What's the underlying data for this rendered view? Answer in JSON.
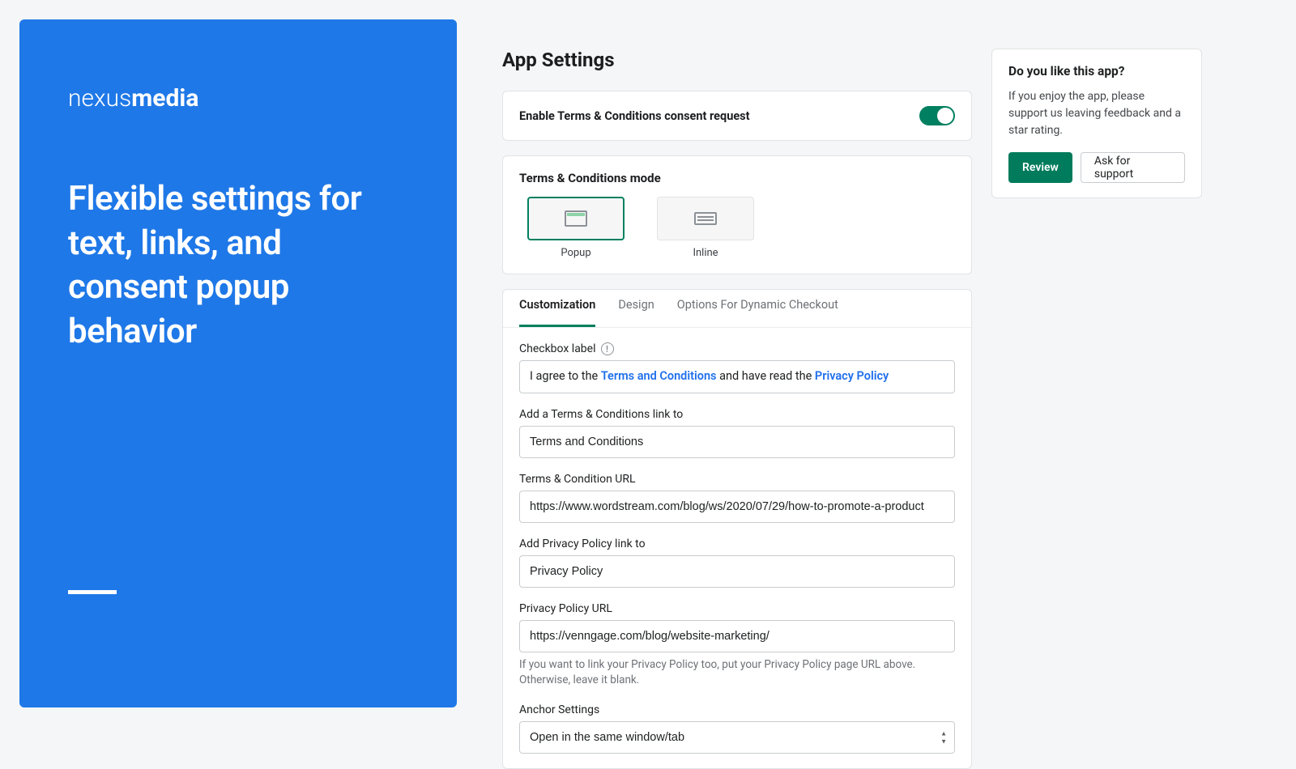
{
  "brand": {
    "prefix": "nexus",
    "bold": "media"
  },
  "headline": "Flexible settings for text, links, and consent popup behavior",
  "page_title": "App Settings",
  "enable": {
    "label": "Enable Terms & Conditions consent request",
    "on": true
  },
  "modes": {
    "title": "Terms & Conditions mode",
    "items": [
      {
        "label": "Popup",
        "selected": true
      },
      {
        "label": "Inline",
        "selected": false
      }
    ]
  },
  "tabs": [
    {
      "label": "Customization",
      "active": true
    },
    {
      "label": "Design",
      "active": false
    },
    {
      "label": "Options For Dynamic Checkout",
      "active": false
    }
  ],
  "form": {
    "checkbox_label_title": "Checkbox label",
    "checkbox_preview": {
      "pre": "I agree to the ",
      "terms_link": "Terms and Conditions",
      "mid": " and have read the ",
      "privacy_link": "Privacy Policy"
    },
    "tc_link_label": "Add a Terms & Conditions link to",
    "tc_link_value": "Terms and Conditions",
    "tc_url_label": "Terms & Condition URL",
    "tc_url_value": "https://www.wordstream.com/blog/ws/2020/07/29/how-to-promote-a-product",
    "pp_link_label": "Add Privacy Policy link to",
    "pp_link_value": "Privacy Policy",
    "pp_url_label": "Privacy Policy URL",
    "pp_url_value": "https://venngage.com/blog/website-marketing/",
    "pp_helper": "If you want to link your Privacy Policy too, put your Privacy Policy page URL above. Otherwise, leave it blank.",
    "anchor_label": "Anchor Settings",
    "anchor_value": "Open in the same window/tab"
  },
  "support": {
    "title": "Do you like this app?",
    "text": "If you enjoy the app, please support us leaving feedback and a star rating.",
    "review_btn": "Review",
    "support_btn": "Ask for support"
  }
}
